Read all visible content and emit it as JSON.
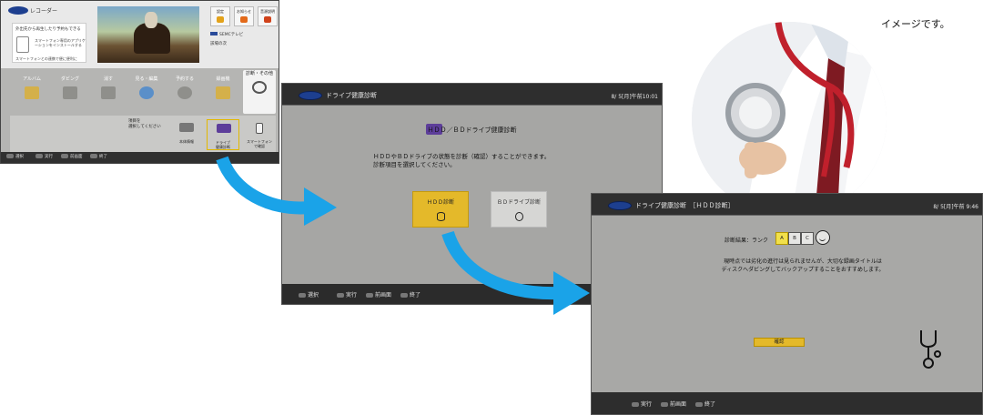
{
  "screen1": {
    "brand": "レコーダー",
    "promo_line1": "外出先から再生したり予約もできる",
    "promo_line2": "スマートフォン専用のアプリケーションをインストールする",
    "promo_line3": "スマートフォンとの連携で便に便利に",
    "quick_buttons": [
      {
        "label": "設定",
        "color": "#e3a21a"
      },
      {
        "label": "お知らせ",
        "color": "#e36a1a"
      },
      {
        "label": "音源説明",
        "color": "#d0421a"
      }
    ],
    "channel": "SEMCテレビ",
    "now_label": "該場の次",
    "categories": [
      "アルバム",
      "ダビング",
      "消す",
      "見る・編集",
      "予約する",
      "録画機",
      "診断・その他"
    ],
    "prompt": "項目を\n選択してください",
    "sub_items": [
      "本体情報",
      "ドライブ\n健康診断",
      "スマートフォン\nで確認"
    ],
    "hints": [
      "選択",
      "実行",
      "前画面",
      "終了"
    ]
  },
  "screen2": {
    "title": "ドライブ健康診断",
    "time": "8/ 5[月]午前10:01",
    "heading": "ＨＤＤ／ＢＤドライブ健康診断",
    "message_line1": "ＨＤＤやＢＤドライブの状態を診断（確認）することができます。",
    "message_line2": "診断項目を選択してください。",
    "btn_hdd": "ＨＤＤ診断",
    "btn_bd": "ＢＤドライブ診断",
    "hints": [
      "選択",
      "実行",
      "前画面",
      "終了"
    ]
  },
  "screen3": {
    "title": "ドライブ健康診断　［ＨＤＤ診断］",
    "time": "8/ 5[月]午前 9:46",
    "rank_label": "診断結果：ランク",
    "ranks": [
      "A",
      "B",
      "C"
    ],
    "result_line1": "現時点では劣化の進行は見られませんが、大切な録画タイトルは",
    "result_line2": "ディスクへダビングしてバックアップすることをおすすめします。",
    "ok_button": "確認",
    "hints": [
      "実行",
      "前画面",
      "終了"
    ]
  },
  "caption": "イメージです。",
  "colors": {
    "accent_yellow": "#e4b92a",
    "arrow_blue": "#1aa3e8"
  }
}
